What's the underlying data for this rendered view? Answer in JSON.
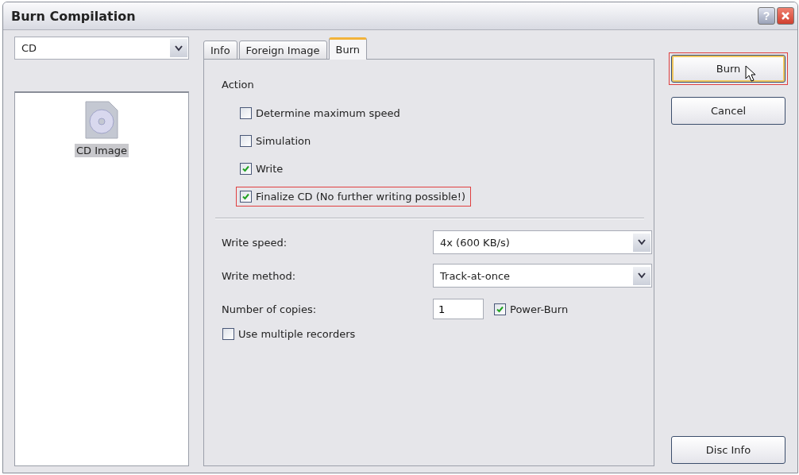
{
  "window": {
    "title": "Burn Compilation",
    "help_button": "?"
  },
  "media_select": {
    "value": "CD"
  },
  "compilation_list": [
    {
      "label": "CD Image",
      "selected": true
    }
  ],
  "tabs": [
    {
      "label": "Info",
      "selected": false
    },
    {
      "label": "Foreign Image",
      "selected": false
    },
    {
      "label": "Burn",
      "selected": true
    }
  ],
  "action": {
    "heading": "Action",
    "options": [
      {
        "label": "Determine maximum speed",
        "checked": false,
        "highlighted": false
      },
      {
        "label": "Simulation",
        "checked": false,
        "highlighted": false
      },
      {
        "label": "Write",
        "checked": true,
        "highlighted": false
      },
      {
        "label": "Finalize CD (No further writing possible!)",
        "checked": true,
        "highlighted": true
      }
    ]
  },
  "settings": [
    {
      "kind": "select",
      "label": "Write speed:",
      "value": "4x (600 KB/s)"
    },
    {
      "kind": "select",
      "label": "Write method:",
      "value": "Track-at-once"
    },
    {
      "kind": "copies",
      "label": "Number of copies:",
      "value": "1",
      "option": {
        "label": "Power-Burn",
        "checked": true
      }
    }
  ],
  "multiple_recorders": {
    "label": "Use multiple recorders",
    "checked": false
  },
  "buttons": [
    {
      "label": "Burn",
      "kind": "default",
      "highlighted": true
    },
    {
      "label": "Cancel",
      "kind": "normal",
      "highlighted": false
    },
    {
      "label": "Disc Info",
      "kind": "bottom",
      "highlighted": false
    }
  ]
}
